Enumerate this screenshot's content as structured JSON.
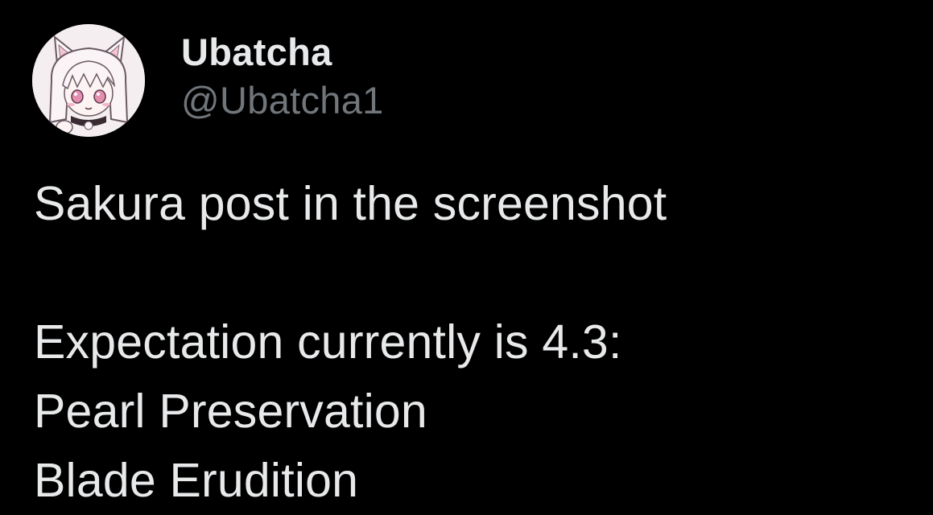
{
  "author": {
    "display_name": "Ubatcha",
    "handle": "@Ubatcha1",
    "avatar_icon": "anime-catgirl-avatar-icon"
  },
  "post": {
    "lines": [
      "Sakura post in the screenshot",
      "",
      "Expectation currently is 4.3:",
      "Pearl Preservation",
      "Blade Erudition"
    ]
  },
  "colors": {
    "background": "#000000",
    "text_primary": "#e7e9ea",
    "text_secondary": "#71767b",
    "avatar_bg": "#f3ecef",
    "avatar_accent": "#e58fb0"
  }
}
